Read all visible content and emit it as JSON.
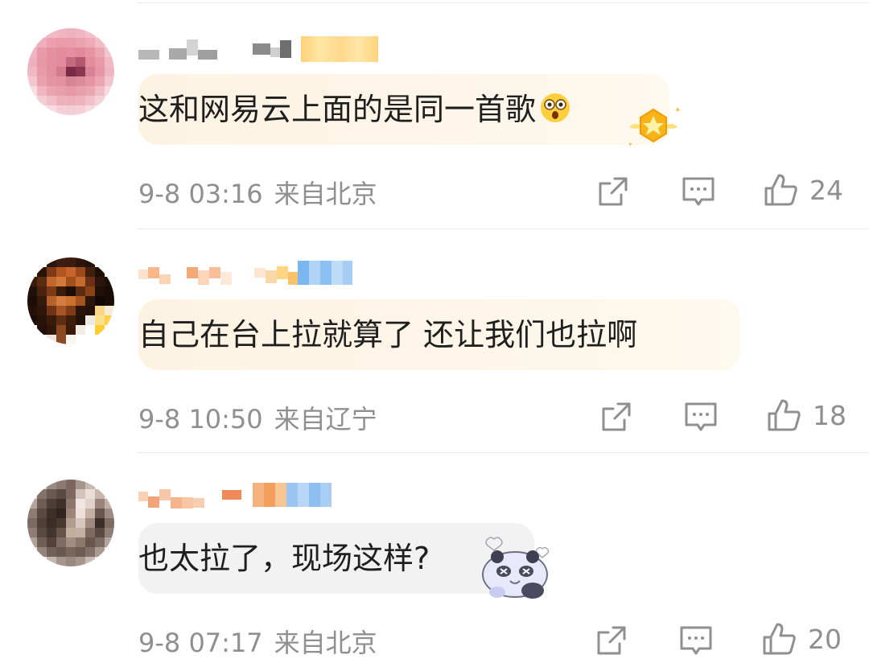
{
  "comments": [
    {
      "text": "这和网易云上面的是同一首歌",
      "time": "9-8 03:16",
      "location": "来自北京",
      "likes": "24",
      "emoji": "shocked-face-emoji"
    },
    {
      "text": "自己在台上拉就算了 还让我们也拉啊",
      "time": "9-8 10:50",
      "location": "来自辽宁",
      "likes": "18"
    },
    {
      "text": "也太拉了，现场这样?",
      "time": "9-8 07:17",
      "location": "来自北京",
      "likes": "20",
      "sticker": "panda-sticker"
    }
  ],
  "icons": {
    "share": "share-icon",
    "reply": "reply-icon",
    "like": "thumbs-up-icon",
    "badge": "gold-badge-icon"
  },
  "colors": {
    "meta_text": "#8f8f8f",
    "bubble_gold_start": "#fdf3df",
    "bubble_gray": "#f2f2f2"
  }
}
